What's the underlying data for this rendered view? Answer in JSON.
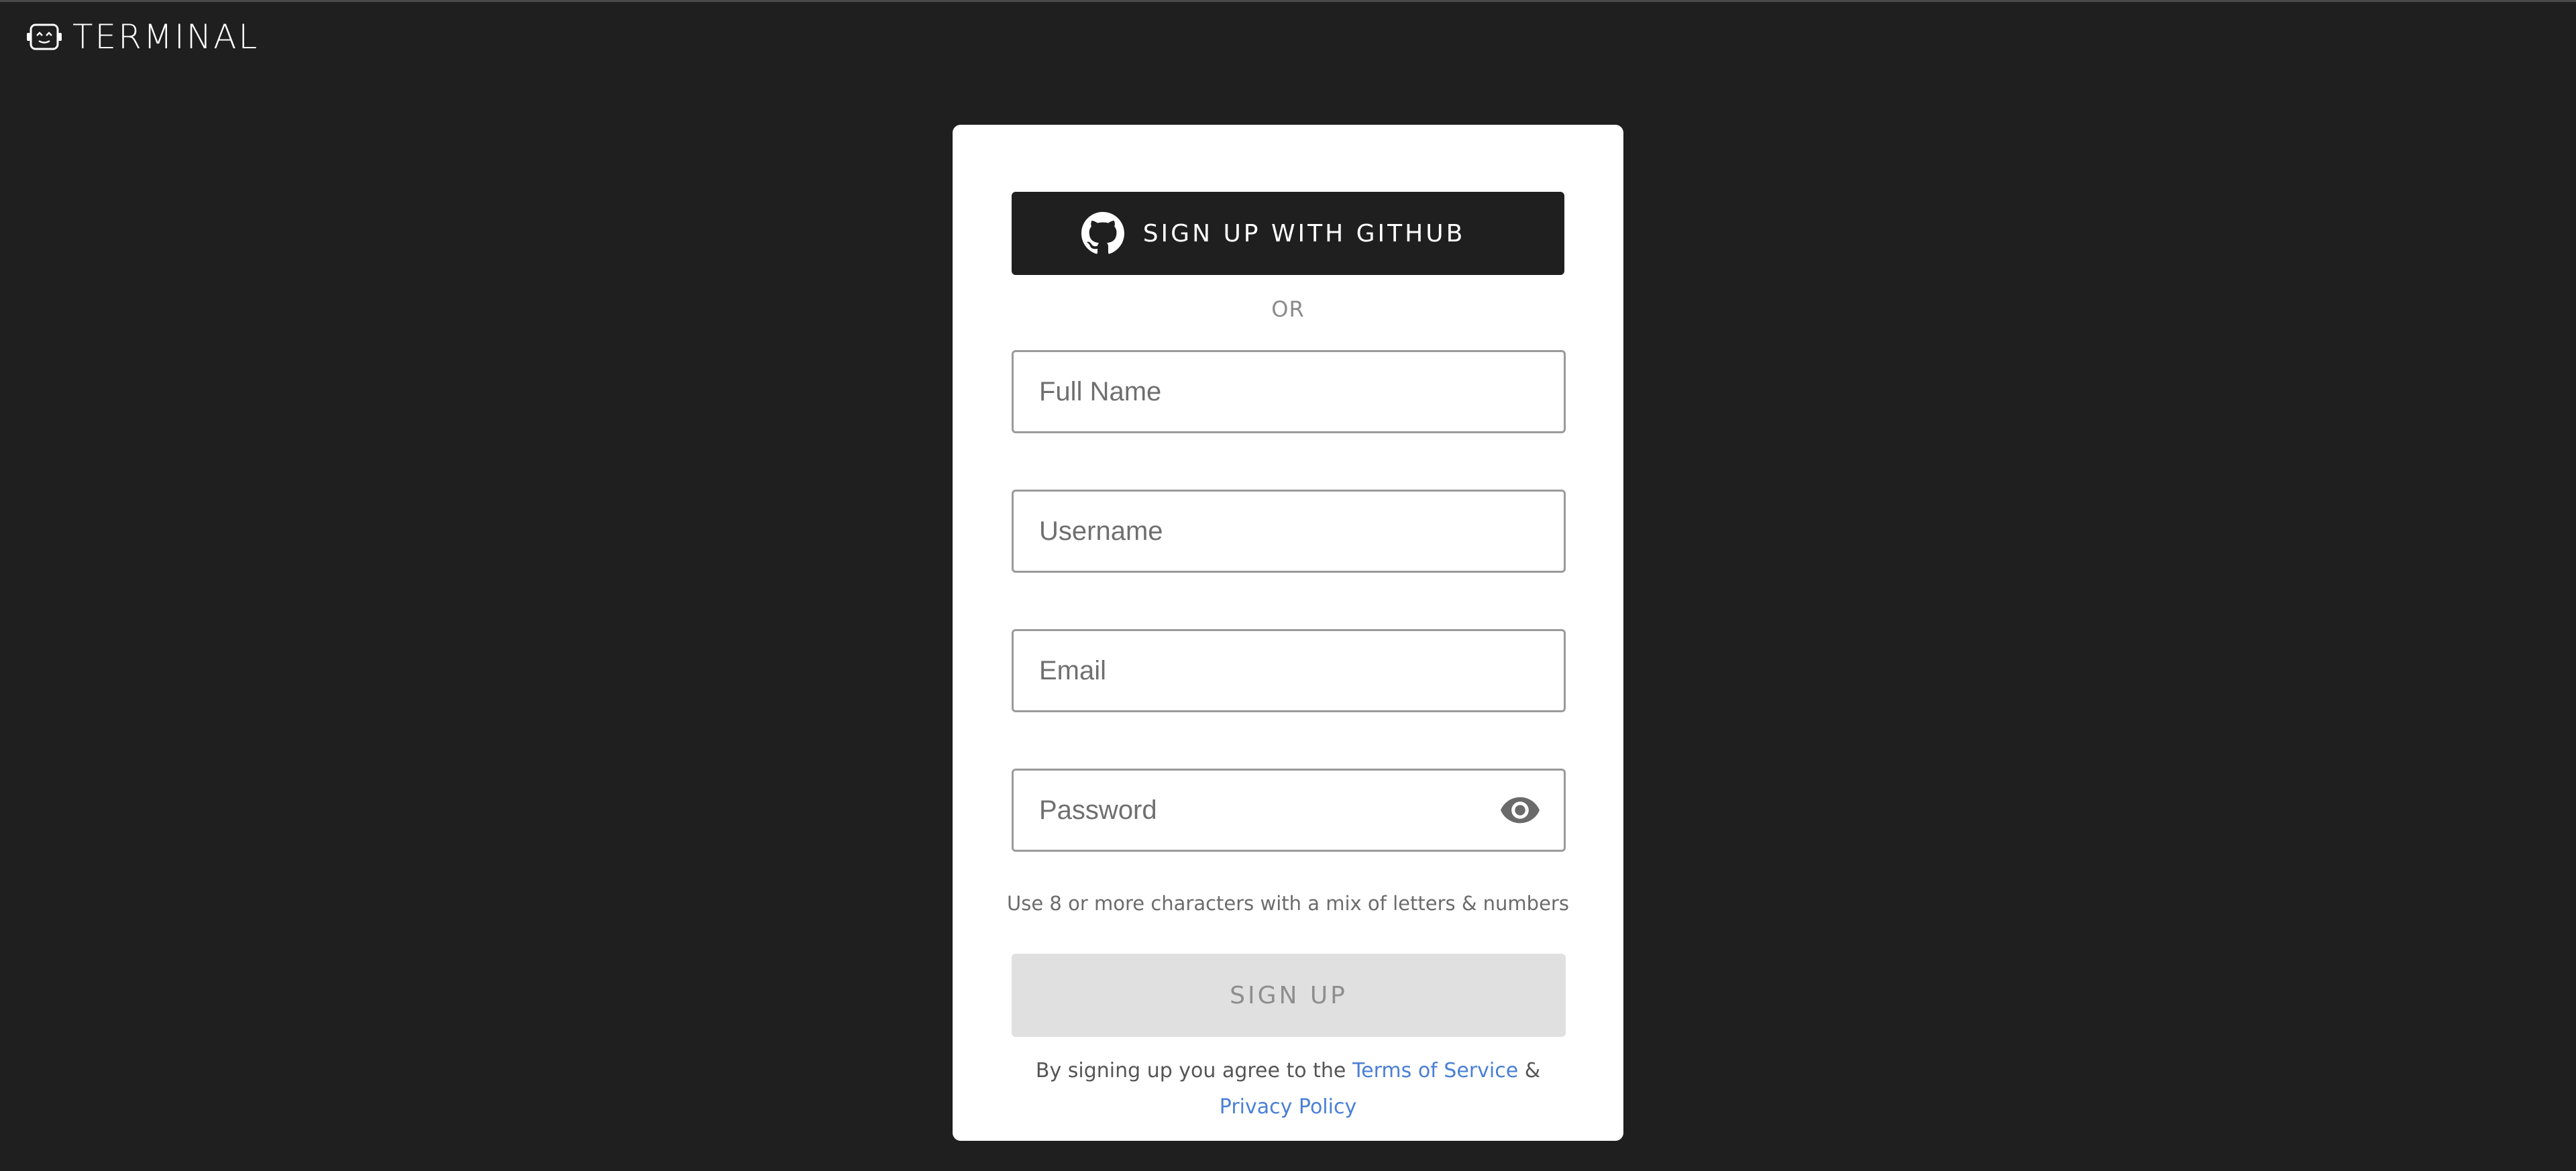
{
  "brand": {
    "name": "TERMINAL",
    "icon": "robot-face-icon"
  },
  "signup": {
    "github_label": "SIGN UP WITH GITHUB",
    "github_icon": "github-icon",
    "or_label": "OR",
    "fields": {
      "full_name_placeholder": "Full Name",
      "username_placeholder": "Username",
      "email_placeholder": "Email",
      "password_placeholder": "Password"
    },
    "password_toggle_icon": "eye-icon",
    "password_hint": "Use 8 or more characters with a mix of letters & numbers",
    "submit_label": "SIGN UP",
    "terms": {
      "prefix": "By signing up you agree to the",
      "tos_link": "Terms of Service",
      "amp": "&",
      "privacy_link": "Privacy Policy"
    }
  },
  "colors": {
    "background": "#1f1f1f",
    "card": "#ffffff",
    "github_button": "#1f1f1f",
    "submit_disabled": "#e0e0e0",
    "link": "#4a7fd6"
  }
}
